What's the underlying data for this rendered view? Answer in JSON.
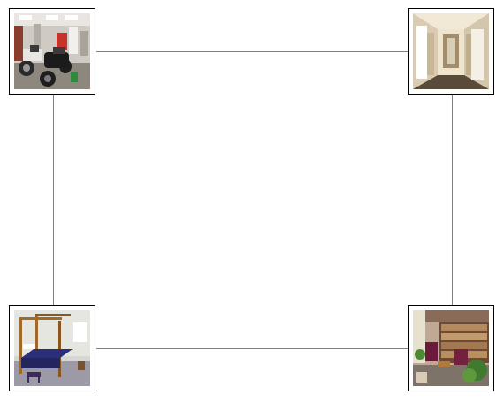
{
  "diagram": {
    "type": "graph",
    "layout": "square",
    "nodes": [
      {
        "id": "top-left",
        "image": "motorcycle-garage-photo"
      },
      {
        "id": "top-right",
        "image": "hallway-photo"
      },
      {
        "id": "bottom-left",
        "image": "canopy-bed-room-photo"
      },
      {
        "id": "bottom-right",
        "image": "bookshelf-sitting-room-photo"
      }
    ],
    "edges": [
      {
        "from": "top-left",
        "to": "top-right"
      },
      {
        "from": "top-left",
        "to": "bottom-left"
      },
      {
        "from": "top-right",
        "to": "bottom-right"
      },
      {
        "from": "bottom-left",
        "to": "bottom-right"
      }
    ],
    "colors": {
      "edge": "#808080",
      "node_border": "#000000",
      "background": "#ffffff"
    }
  }
}
